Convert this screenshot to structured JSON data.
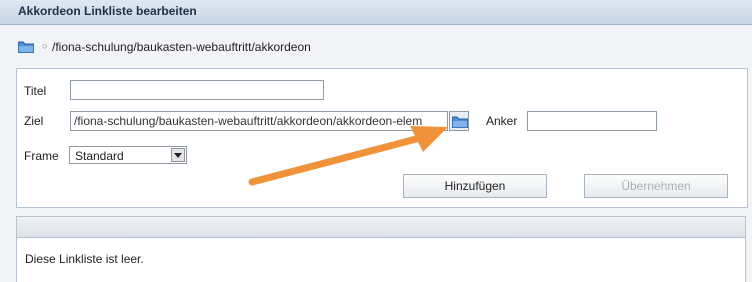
{
  "window": {
    "title": "Akkordeon Linkliste bearbeiten"
  },
  "breadcrumb": {
    "path": "/fiona-schulung/baukasten-webauftritt/akkordeon",
    "bullet": "○"
  },
  "form": {
    "titel_label": "Titel",
    "titel_value": "",
    "ziel_label": "Ziel",
    "ziel_value": "/fiona-schulung/baukasten-webauftritt/akkordeon/akkordeon-elem",
    "anker_label": "Anker",
    "anker_value": "",
    "frame_label": "Frame",
    "frame_value": "Standard",
    "add_button": "Hinzufügen",
    "apply_button": "Übernehmen"
  },
  "list": {
    "header": "",
    "empty_text": "Diese Linkliste ist leer."
  },
  "colors": {
    "annotation_arrow": "#f0923a",
    "folder_icon": "#3c82d4"
  }
}
